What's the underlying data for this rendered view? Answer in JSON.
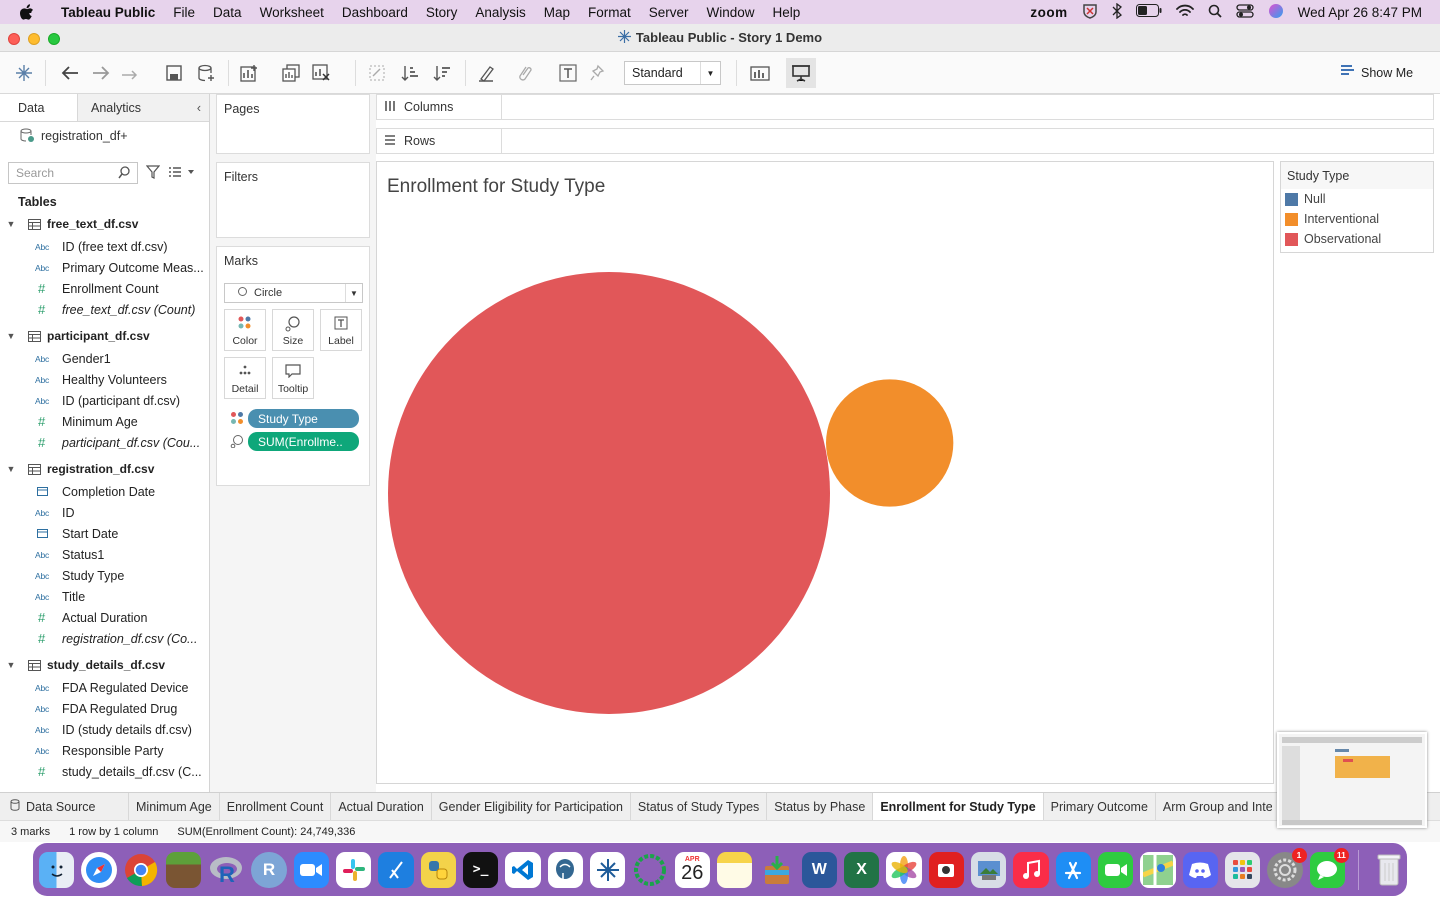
{
  "menubar": {
    "app": "Tableau Public",
    "items": [
      "File",
      "Data",
      "Worksheet",
      "Dashboard",
      "Story",
      "Analysis",
      "Map",
      "Format",
      "Server",
      "Window",
      "Help"
    ],
    "zoom_label": "zoom",
    "datetime": "Wed Apr 26  8:47 PM"
  },
  "window": {
    "title": "Tableau Public - Story 1 Demo"
  },
  "toolbar": {
    "fit_select": "Standard",
    "show_me": "Show Me"
  },
  "data_pane": {
    "tab_data": "Data",
    "tab_analytics": "Analytics",
    "datasource": "registration_df+",
    "search_placeholder": "Search",
    "tables_heading": "Tables",
    "tables": [
      {
        "name": "free_text_df.csv",
        "fields": [
          {
            "type": "Abc",
            "name": "ID (free text df.csv)"
          },
          {
            "type": "Abc",
            "name": "Primary Outcome Meas..."
          },
          {
            "type": "#",
            "name": "Enrollment Count"
          },
          {
            "type": "#",
            "name": "free_text_df.csv (Count)"
          }
        ]
      },
      {
        "name": "participant_df.csv",
        "fields": [
          {
            "type": "Abc",
            "name": "Gender1"
          },
          {
            "type": "Abc",
            "name": "Healthy Volunteers"
          },
          {
            "type": "Abc",
            "name": "ID (participant df.csv)"
          },
          {
            "type": "#",
            "name": "Minimum Age"
          },
          {
            "type": "#",
            "name": "participant_df.csv (Cou..."
          }
        ]
      },
      {
        "name": "registration_df.csv",
        "fields": [
          {
            "type": "date",
            "name": "Completion Date"
          },
          {
            "type": "Abc",
            "name": "ID"
          },
          {
            "type": "date",
            "name": "Start Date"
          },
          {
            "type": "Abc",
            "name": "Status1"
          },
          {
            "type": "Abc",
            "name": "Study Type"
          },
          {
            "type": "Abc",
            "name": "Title"
          },
          {
            "type": "#",
            "name": "Actual Duration"
          },
          {
            "type": "#",
            "name": "registration_df.csv (Co..."
          }
        ]
      },
      {
        "name": "study_details_df.csv",
        "fields": [
          {
            "type": "Abc",
            "name": "FDA Regulated Device"
          },
          {
            "type": "Abc",
            "name": "FDA Regulated Drug"
          },
          {
            "type": "Abc",
            "name": "ID (study details df.csv)"
          },
          {
            "type": "Abc",
            "name": "Responsible Party"
          },
          {
            "type": "#",
            "name": "study_details_df.csv (C..."
          }
        ]
      }
    ]
  },
  "cards": {
    "pages": "Pages",
    "filters": "Filters",
    "marks": "Marks",
    "mark_type": "Circle",
    "buttons": [
      "Color",
      "Size",
      "Label",
      "Detail",
      "Tooltip"
    ],
    "pills": [
      "Study Type",
      "SUM(Enrollme.."
    ]
  },
  "shelves": {
    "columns": "Columns",
    "rows": "Rows"
  },
  "view": {
    "title": "Enrollment for Study Type"
  },
  "chart_data": {
    "type": "bubble",
    "title": "Enrollment for Study Type",
    "size_measure": "SUM(Enrollment Count)",
    "color_dimension": "Study Type",
    "total": 24749336,
    "series": [
      {
        "name": "Observational",
        "relative_size": 1.0,
        "color": "#e15759"
      },
      {
        "name": "Interventional",
        "relative_size": 0.083,
        "color": "#f28e2b"
      },
      {
        "name": "Null",
        "relative_size": 0,
        "color": "#4e79a7"
      }
    ]
  },
  "legend": {
    "title": "Study Type",
    "items": [
      {
        "label": "Null",
        "color": "#4e79a7"
      },
      {
        "label": "Interventional",
        "color": "#f28e2b"
      },
      {
        "label": "Observational",
        "color": "#e15759"
      }
    ]
  },
  "sheet_tabs": {
    "datasource": "Data Source",
    "tabs": [
      "Minimum Age",
      "Enrollment Count",
      "Actual Duration",
      "Gender Eligibility for Participation",
      "Status of Study Types",
      "Status by Phase",
      "Enrollment for Study Type",
      "Primary Outcome",
      "Arm Group and Inter"
    ],
    "active": "Enrollment for Study Type"
  },
  "status": {
    "marks": "3 marks",
    "rows_cols": "1 row by 1 column",
    "sum": "SUM(Enrollment Count): 24,749,336"
  },
  "dock": {
    "calendar_month": "APR",
    "calendar_day": "26",
    "settings_badge": "1",
    "messages_badge": "11"
  }
}
